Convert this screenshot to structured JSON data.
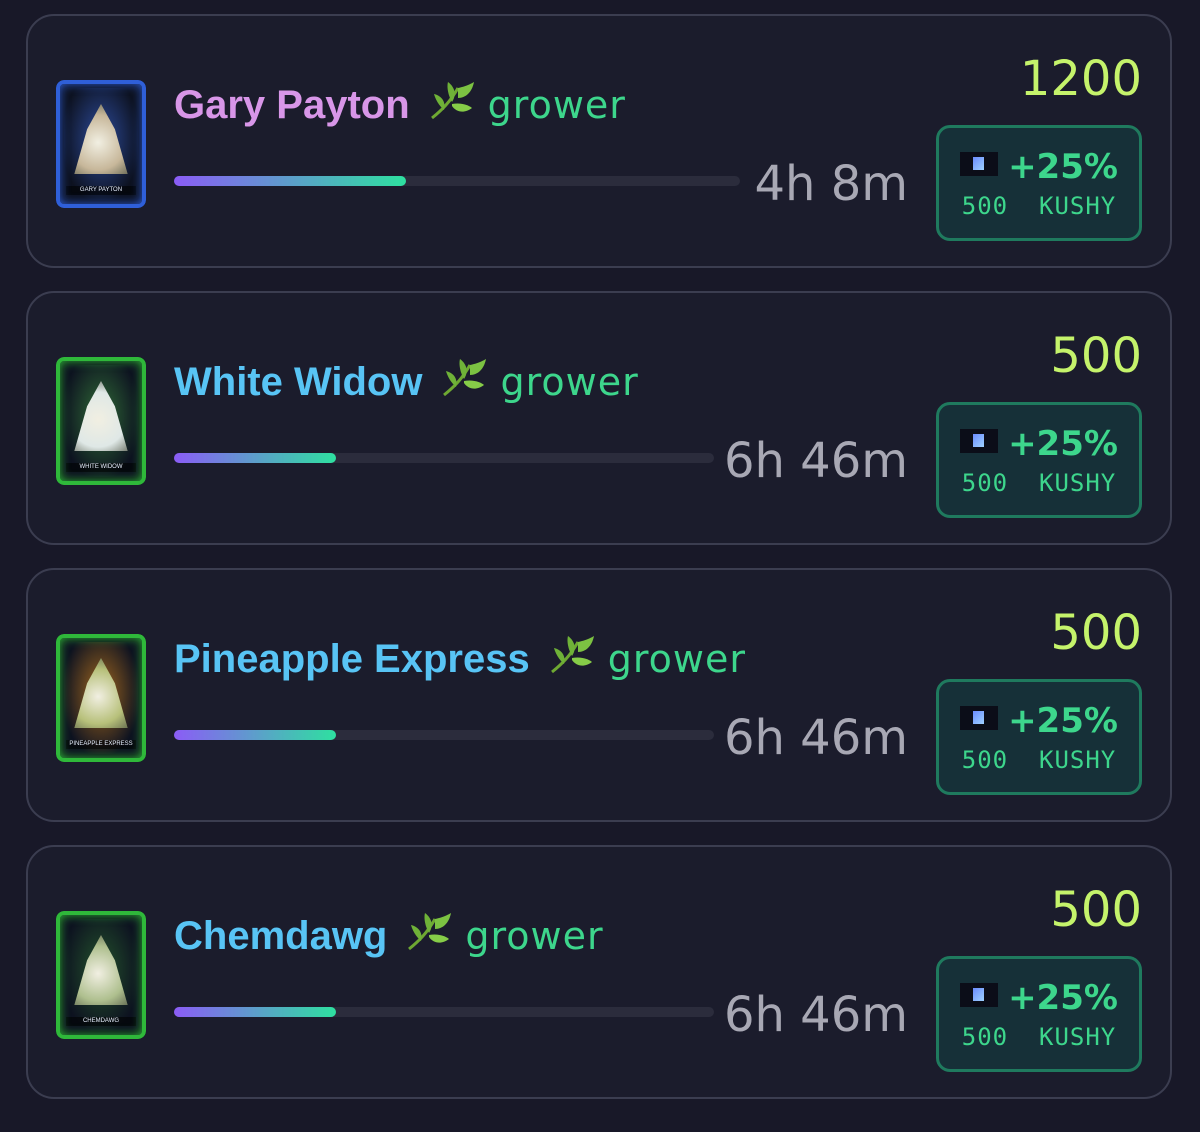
{
  "colors": {
    "background": "#181828",
    "card_border": "#3b3d50",
    "role_green": "#3dd68c",
    "amount_lime": "#c5f36b",
    "progress_start": "#8b5cf6",
    "progress_end": "#2ee0a0"
  },
  "cards": [
    {
      "name": "Gary Payton",
      "name_color": "#d896e8",
      "card_label": "GARY PAYTON",
      "leaf_icon": "herb-leaf-icon",
      "role": "grower",
      "progress": 0.41,
      "time_left": "4h 8m",
      "amount": "1200",
      "boost": {
        "token_icon": "kushy-token-icon",
        "percent": "+25%",
        "cost": "500  KUSHY"
      }
    },
    {
      "name": "White Widow",
      "name_color": "#58c4f5",
      "card_label": "WHITE WIDOW",
      "leaf_icon": "herb-leaf-icon",
      "role": "grower",
      "progress": 0.3,
      "time_left": "6h 46m",
      "amount": "500",
      "boost": {
        "token_icon": "kushy-token-icon",
        "percent": "+25%",
        "cost": "500  KUSHY"
      }
    },
    {
      "name": "Pineapple Express",
      "name_color": "#58c4f5",
      "card_label": "PINEAPPLE EXPRESS",
      "leaf_icon": "herb-leaf-icon",
      "role": "grower",
      "progress": 0.3,
      "time_left": "6h 46m",
      "amount": "500",
      "boost": {
        "token_icon": "kushy-token-icon",
        "percent": "+25%",
        "cost": "500  KUSHY"
      }
    },
    {
      "name": "Chemdawg",
      "name_color": "#58c4f5",
      "card_label": "CHEMDAWG",
      "leaf_icon": "herb-leaf-icon",
      "role": "grower",
      "progress": 0.3,
      "time_left": "6h 46m",
      "amount": "500",
      "boost": {
        "token_icon": "kushy-token-icon",
        "percent": "+25%",
        "cost": "500  KUSHY"
      }
    }
  ]
}
